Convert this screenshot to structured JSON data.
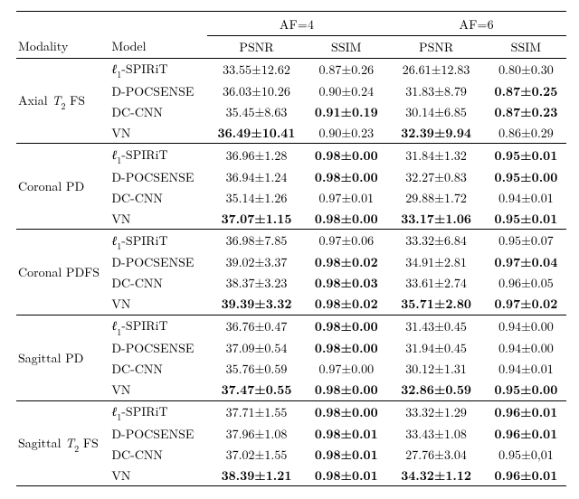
{
  "chart_data": {
    "type": "table",
    "title": "",
    "columns_top": [
      "AF=4",
      "AF=6"
    ],
    "columns_sub": [
      "PSNR",
      "SSIM",
      "PSNR",
      "SSIM"
    ],
    "row_headers": [
      "Modality",
      "Model"
    ],
    "groups": [
      {
        "modality_plain": "Axial T2 FS",
        "modality_html": "Axial <span class='ell'>T</span><span class='sub'>2</span> FS",
        "rows": [
          {
            "model_key": "l1spirit",
            "af4_psnr": "33.55±12.62",
            "af4_psnr_b": false,
            "af4_ssim": "0.87±0.26",
            "af4_ssim_b": false,
            "af6_psnr": "26.61±12.83",
            "af6_psnr_b": false,
            "af6_ssim": "0.80±0.30",
            "af6_ssim_b": false
          },
          {
            "model_key": "dpocsense",
            "af4_psnr": "36.03±10.26",
            "af4_psnr_b": false,
            "af4_ssim": "0.90±0.24",
            "af4_ssim_b": false,
            "af6_psnr": "31.83±8.79",
            "af6_psnr_b": false,
            "af6_ssim": "0.87±0.25",
            "af6_ssim_b": true
          },
          {
            "model_key": "dccnn",
            "af4_psnr": "35.45±8.63",
            "af4_psnr_b": false,
            "af4_ssim": "0.91±0.19",
            "af4_ssim_b": true,
            "af6_psnr": "30.14±6.85",
            "af6_psnr_b": false,
            "af6_ssim": "0.87±0.23",
            "af6_ssim_b": true
          },
          {
            "model_key": "vn",
            "af4_psnr": "36.49±10.41",
            "af4_psnr_b": true,
            "af4_ssim": "0.90±0.23",
            "af4_ssim_b": false,
            "af6_psnr": "32.39±9.94",
            "af6_psnr_b": true,
            "af6_ssim": "0.86±0.29",
            "af6_ssim_b": false
          }
        ]
      },
      {
        "modality_plain": "Coronal PD",
        "modality_html": "Coronal PD",
        "rows": [
          {
            "model_key": "l1spirit",
            "af4_psnr": "36.96±1.28",
            "af4_psnr_b": false,
            "af4_ssim": "0.98±0.00",
            "af4_ssim_b": true,
            "af6_psnr": "31.84±1.32",
            "af6_psnr_b": false,
            "af6_ssim": "0.95±0.01",
            "af6_ssim_b": true
          },
          {
            "model_key": "dpocsense",
            "af4_psnr": "36.94±1.24",
            "af4_psnr_b": false,
            "af4_ssim": "0.98±0.00",
            "af4_ssim_b": true,
            "af6_psnr": "32.27±0.83",
            "af6_psnr_b": false,
            "af6_ssim": "0.95±0.00",
            "af6_ssim_b": true
          },
          {
            "model_key": "dccnn",
            "af4_psnr": "35.14±1.26",
            "af4_psnr_b": false,
            "af4_ssim": "0.97±0.01",
            "af4_ssim_b": false,
            "af6_psnr": "29.88±1.72",
            "af6_psnr_b": false,
            "af6_ssim": "0.94±0.01",
            "af6_ssim_b": false
          },
          {
            "model_key": "vn",
            "af4_psnr": "37.07±1.15",
            "af4_psnr_b": true,
            "af4_ssim": "0.98±0.00",
            "af4_ssim_b": true,
            "af6_psnr": "33.17±1.06",
            "af6_psnr_b": true,
            "af6_ssim": "0.95±0.01",
            "af6_ssim_b": true
          }
        ]
      },
      {
        "modality_plain": "Coronal PDFS",
        "modality_html": "Coronal PDFS",
        "rows": [
          {
            "model_key": "l1spirit",
            "af4_psnr": "36.98±7.85",
            "af4_psnr_b": false,
            "af4_ssim": "0.97±0.06",
            "af4_ssim_b": false,
            "af6_psnr": "33.32±6.84",
            "af6_psnr_b": false,
            "af6_ssim": "0.95±0.07",
            "af6_ssim_b": false
          },
          {
            "model_key": "dpocsense",
            "af4_psnr": "39.02±3.37",
            "af4_psnr_b": false,
            "af4_ssim": "0.98±0.02",
            "af4_ssim_b": true,
            "af6_psnr": "34.91±2.81",
            "af6_psnr_b": false,
            "af6_ssim": "0.97±0.04",
            "af6_ssim_b": true
          },
          {
            "model_key": "dccnn",
            "af4_psnr": "38.37±3.23",
            "af4_psnr_b": false,
            "af4_ssim": "0.98±0.03",
            "af4_ssim_b": true,
            "af6_psnr": "33.61±2.74",
            "af6_psnr_b": false,
            "af6_ssim": "0.96±0.05",
            "af6_ssim_b": false
          },
          {
            "model_key": "vn",
            "af4_psnr": "39.39±3.32",
            "af4_psnr_b": true,
            "af4_ssim": "0.98±0.02",
            "af4_ssim_b": true,
            "af6_psnr": "35.71±2.80",
            "af6_psnr_b": true,
            "af6_ssim": "0.97±0.02",
            "af6_ssim_b": true
          }
        ]
      },
      {
        "modality_plain": "Sagittal PD",
        "modality_html": "Sagittal PD",
        "rows": [
          {
            "model_key": "l1spirit",
            "af4_psnr": "36.76±0.47",
            "af4_psnr_b": false,
            "af4_ssim": "0.98±0.00",
            "af4_ssim_b": true,
            "af6_psnr": "31.43±0.45",
            "af6_psnr_b": false,
            "af6_ssim": "0.94±0.00",
            "af6_ssim_b": false
          },
          {
            "model_key": "dpocsense",
            "af4_psnr": "37.09±0.54",
            "af4_psnr_b": false,
            "af4_ssim": "0.98±0.00",
            "af4_ssim_b": true,
            "af6_psnr": "31.94±0.45",
            "af6_psnr_b": false,
            "af6_ssim": "0.94±0.00",
            "af6_ssim_b": false
          },
          {
            "model_key": "dccnn",
            "af4_psnr": "35.76±0.59",
            "af4_psnr_b": false,
            "af4_ssim": "0.97±0.00",
            "af4_ssim_b": false,
            "af6_psnr": "30.12±1.31",
            "af6_psnr_b": false,
            "af6_ssim": "0.94±0.01",
            "af6_ssim_b": false
          },
          {
            "model_key": "vn",
            "af4_psnr": "37.47±0.55",
            "af4_psnr_b": true,
            "af4_ssim": "0.98±0.00",
            "af4_ssim_b": true,
            "af6_psnr": "32.86±0.59",
            "af6_psnr_b": true,
            "af6_ssim": "0.95±0.00",
            "af6_ssim_b": true
          }
        ]
      },
      {
        "modality_plain": "Sagittal T2 FS",
        "modality_html": "Sagittal <span class='ell'>T</span><span class='sub'>2</span> FS",
        "rows": [
          {
            "model_key": "l1spirit",
            "af4_psnr": "37.71±1.55",
            "af4_psnr_b": false,
            "af4_ssim": "0.98±0.00",
            "af4_ssim_b": true,
            "af6_psnr": "33.32±1.29",
            "af6_psnr_b": false,
            "af6_ssim": "0.96±0.01",
            "af6_ssim_b": true
          },
          {
            "model_key": "dpocsense",
            "af4_psnr": "37.96±1.08",
            "af4_psnr_b": false,
            "af4_ssim": "0.98±0.01",
            "af4_ssim_b": true,
            "af6_psnr": "33.43±1.08",
            "af6_psnr_b": false,
            "af6_ssim": "0.96±0.01",
            "af6_ssim_b": true
          },
          {
            "model_key": "dccnn",
            "af4_psnr": "37.02±1.55",
            "af4_psnr_b": false,
            "af4_ssim": "0.98±0.01",
            "af4_ssim_b": true,
            "af6_psnr": "27.76±3.04",
            "af6_psnr_b": false,
            "af6_ssim": "0.95±0,01",
            "af6_ssim_b": false
          },
          {
            "model_key": "vn",
            "af4_psnr": "38.39±1.21",
            "af4_psnr_b": true,
            "af4_ssim": "0.98±0.01",
            "af4_ssim_b": true,
            "af6_psnr": "34.32±1.12",
            "af6_psnr_b": true,
            "af6_ssim": "0.96±0.01",
            "af6_ssim_b": true
          }
        ]
      }
    ],
    "model_labels": {
      "l1spirit_html": "<span class='ell'>ℓ</span><span class='sub'>1</span>-SPIRiT",
      "dpocsense": "D-POCSENSE",
      "dccnn": "DC-CNN",
      "vn": "VN"
    }
  },
  "header": {
    "modality": "Modality",
    "model": "Model",
    "af4": "AF=4",
    "af6": "AF=6",
    "psnr": "PSNR",
    "ssim": "SSIM"
  }
}
